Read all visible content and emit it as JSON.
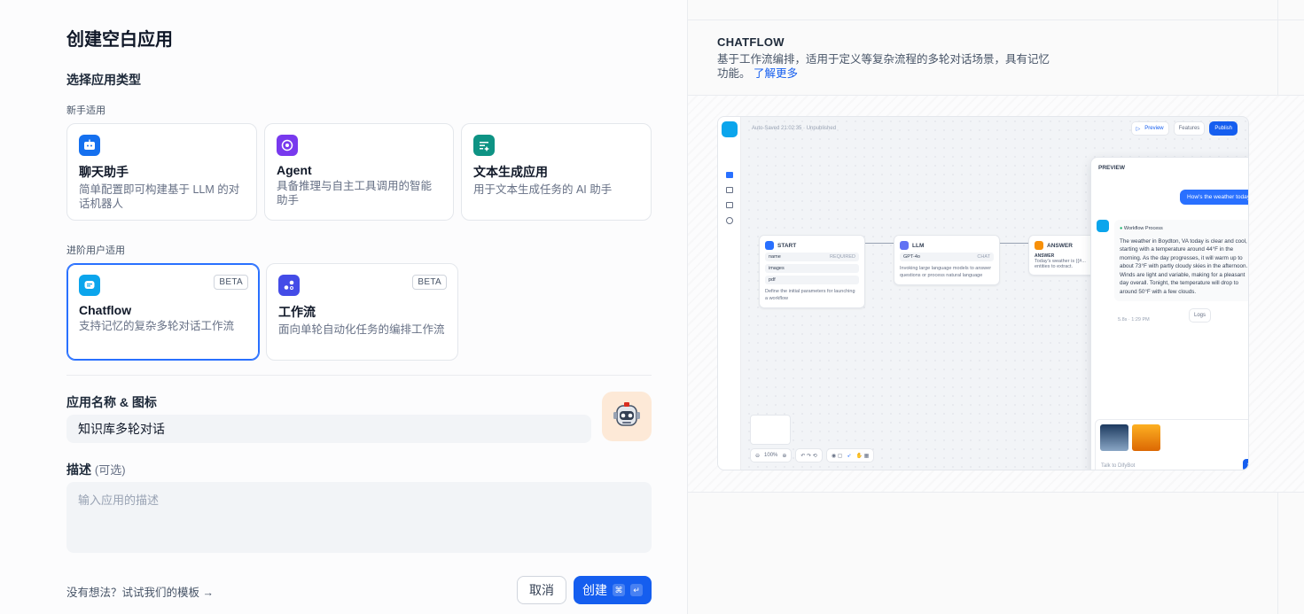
{
  "page": {
    "title": "创建空白应用",
    "section_type": "选择应用类型",
    "group_beginner": "新手适用",
    "group_advanced": "进阶用户适用"
  },
  "cards": [
    {
      "title": "聊天助手",
      "desc": "简单配置即可构建基于 LLM 的对话机器人",
      "icon": "chat-bot-icon",
      "color": "#1570ef"
    },
    {
      "title": "Agent",
      "desc": "具备推理与自主工具调用的智能助手",
      "icon": "agent-icon",
      "color": "#7839ee"
    },
    {
      "title": "文本生成应用",
      "desc": "用于文本生成任务的 AI 助手",
      "icon": "text-gen-icon",
      "color": "#0e9384"
    },
    {
      "title": "Chatflow",
      "desc": "支持记忆的复杂多轮对话工作流",
      "badge": "BETA",
      "icon": "chatflow-icon",
      "color": "#0ba5ec"
    },
    {
      "title": "工作流",
      "desc": "面向单轮自动化任务的编排工作流",
      "badge": "BETA",
      "icon": "workflow-icon",
      "color": "#444ce7"
    }
  ],
  "form": {
    "name_label": "应用名称 & 图标",
    "name_value": "知识库多轮对话",
    "desc_label": "描述",
    "desc_optional": "(可选)",
    "desc_placeholder": "输入应用的描述"
  },
  "footer": {
    "template_link": "没有想法？试试我们的模板",
    "cancel": "取消",
    "create": "创建",
    "kbd_cmd": "⌘",
    "kbd_enter": "↵"
  },
  "preview": {
    "title": "CHATFLOW",
    "desc": "基于工作流编排，适用于定义等复杂流程的多轮对话场景，具有记忆功能。",
    "learn_more": "了解更多",
    "mock": {
      "autosave": "Auto-Saved 21:02:35 · Unpublished",
      "preview_btn": "Preview",
      "features_btn": "Features",
      "publish_btn": "Publish",
      "start": {
        "title": "START",
        "vars": [
          "name",
          "images",
          "pdf"
        ],
        "required": "REQUIRED",
        "note": "Define the initial parameters for launching a workflow"
      },
      "llm": {
        "title": "LLM",
        "model": "GPT-4o",
        "mode": "CHAT",
        "note": "Invoking large language models to answer questions or process natural language"
      },
      "answer": {
        "title": "ANSWER",
        "label": "ANSWER",
        "text": "Today's weather is {{#...",
        "text2": "entities to extract."
      },
      "chat_title": "PREVIEW",
      "user_msg": "How's the weather today",
      "process": "Workflow Process",
      "bot_msg": "The weather in Boydton, VA today is clear and cool, starting with a temperature around 44°F in the morning. As the day progresses, it will warm up to about 73°F with partly cloudy skies in the afternoon. Winds are light and variable, making for a pleasant day overall. Tonight, the temperature will drop to around 50°F with a few clouds.",
      "meta": "5.8s · 1:29 PM",
      "logs": "Logs",
      "input_placeholder": "Talk to DifyBot",
      "zoom": "100%"
    }
  }
}
